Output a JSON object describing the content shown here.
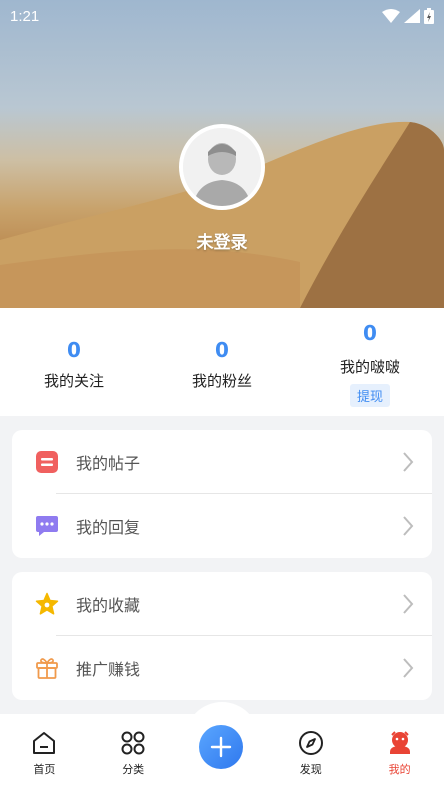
{
  "status": {
    "time": "1:21"
  },
  "profile": {
    "username": "未登录"
  },
  "stats": [
    {
      "value": "0",
      "label": "我的关注"
    },
    {
      "value": "0",
      "label": "我的粉丝"
    },
    {
      "value": "0",
      "label": "我的啵啵",
      "action": "提现"
    }
  ],
  "menu": {
    "group1": [
      {
        "label": "我的帖子",
        "icon": "post-icon",
        "color": "#f0605f"
      },
      {
        "label": "我的回复",
        "icon": "reply-icon",
        "color": "#8f7bf0"
      }
    ],
    "group2": [
      {
        "label": "我的收藏",
        "icon": "star-icon",
        "color": "#f5b800"
      },
      {
        "label": "推广赚钱",
        "icon": "gift-icon",
        "color": "#f09a4c"
      }
    ]
  },
  "tabbar": {
    "items": [
      {
        "label": "首页",
        "icon": "home-icon"
      },
      {
        "label": "分类",
        "icon": "category-icon"
      },
      {
        "label": "",
        "icon": "plus-icon"
      },
      {
        "label": "发现",
        "icon": "compass-icon"
      },
      {
        "label": "我的",
        "icon": "profile-icon"
      }
    ],
    "active": "我的"
  },
  "colors": {
    "accent": "#3f8cf2",
    "active_tab": "#e94435"
  }
}
